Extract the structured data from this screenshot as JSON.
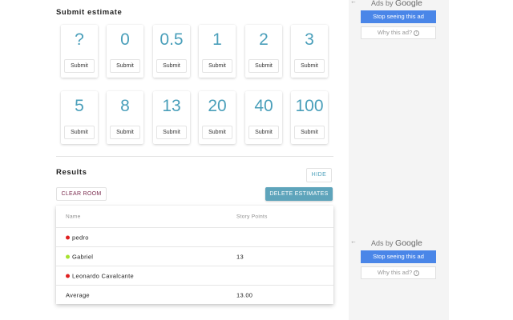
{
  "estimate": {
    "title": "Submit estimate",
    "submit_label": "Submit",
    "cards": [
      {
        "value": "?"
      },
      {
        "value": "0"
      },
      {
        "value": "0.5"
      },
      {
        "value": "1"
      },
      {
        "value": "2"
      },
      {
        "value": "3"
      },
      {
        "value": "5"
      },
      {
        "value": "8"
      },
      {
        "value": "13"
      },
      {
        "value": "20"
      },
      {
        "value": "40"
      },
      {
        "value": "100"
      }
    ]
  },
  "results": {
    "title": "Results",
    "hide_label": "HIDE",
    "clear_label": "CLEAR ROOM",
    "delete_label": "DELETE ESTIMATES",
    "columns": {
      "name": "Name",
      "points": "Story Points"
    },
    "rows": [
      {
        "name": "pedro",
        "points": "",
        "status_color": "#e02020"
      },
      {
        "name": "Gabriel",
        "points": "13",
        "status_color": "#a6e22e"
      },
      {
        "name": "Leonardo Cavalcante",
        "points": "",
        "status_color": "#e02020"
      }
    ],
    "average": {
      "label": "Average",
      "value": "13.00"
    }
  },
  "ads": {
    "back_icon": "back-arrow-icon",
    "ads_by": "Ads by",
    "brand": "Google",
    "stop_label": "Stop seeing this ad",
    "why_label": "Why this ad?",
    "info_icon": "info-icon"
  }
}
